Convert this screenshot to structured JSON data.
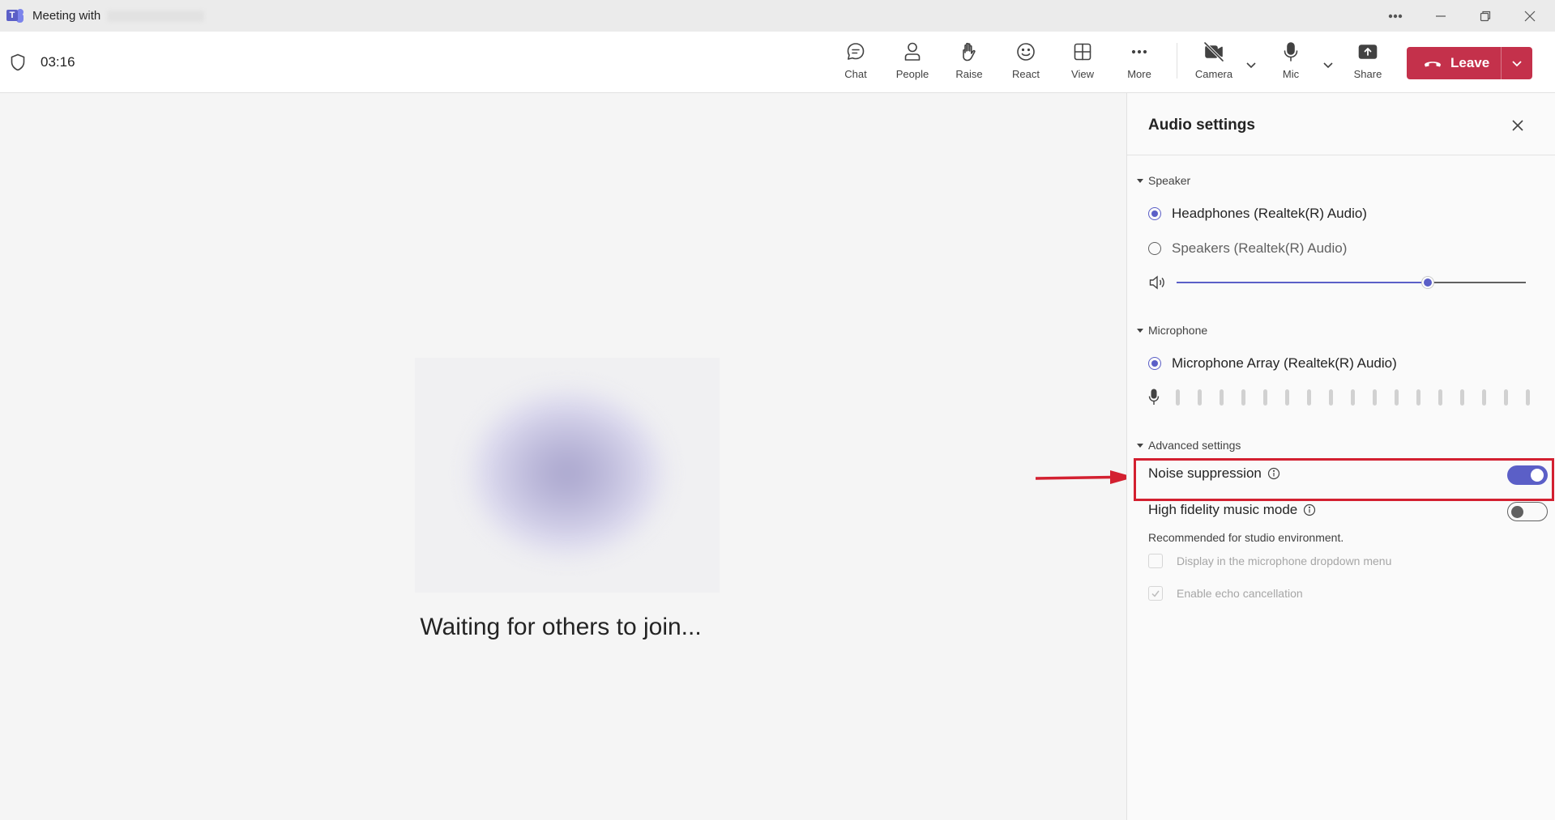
{
  "titlebar": {
    "app_icon": "teams-logo-icon",
    "title": "Meeting with",
    "controls": [
      "more-options-icon",
      "minimize-icon",
      "restore-icon",
      "close-icon"
    ]
  },
  "toolbar": {
    "shield_icon": "shield-icon",
    "timer": "03:16",
    "buttons": [
      {
        "label": "Chat",
        "icon": "chat-icon"
      },
      {
        "label": "People",
        "icon": "people-icon"
      },
      {
        "label": "Raise",
        "icon": "hand-icon"
      },
      {
        "label": "React",
        "icon": "smiley-icon"
      },
      {
        "label": "View",
        "icon": "grid-icon"
      },
      {
        "label": "More",
        "icon": "ellipsis-icon"
      },
      {
        "label": "Camera",
        "icon": "camera-off-icon"
      },
      {
        "label": "Mic",
        "icon": "mic-icon"
      },
      {
        "label": "Share",
        "icon": "share-icon"
      }
    ],
    "leave_label": "Leave"
  },
  "stage": {
    "waiting_text": "Waiting for others to join..."
  },
  "panel": {
    "title": "Audio settings",
    "speaker": {
      "heading": "Speaker",
      "options": [
        {
          "label": "Headphones (Realtek(R) Audio)",
          "selected": true
        },
        {
          "label": "Speakers (Realtek(R) Audio)",
          "selected": false
        }
      ],
      "volume_percent": 72
    },
    "microphone": {
      "heading": "Microphone",
      "options": [
        {
          "label": "Microphone Array (Realtek(R) Audio)",
          "selected": true
        }
      ],
      "level_bars": 17
    },
    "advanced": {
      "heading": "Advanced settings",
      "noise_suppression": {
        "label": "Noise suppression",
        "on": true
      },
      "hifi_music": {
        "label": "High fidelity music mode",
        "on": false,
        "note": "Recommended for studio environment."
      },
      "display_in_dropdown": {
        "label": "Display in the microphone dropdown menu",
        "checked": false
      },
      "echo_cancellation": {
        "label": "Enable echo cancellation",
        "checked": true
      }
    }
  },
  "colors": {
    "accent": "#5b5fc7",
    "leave": "#c4314b",
    "highlight": "#d32030"
  }
}
